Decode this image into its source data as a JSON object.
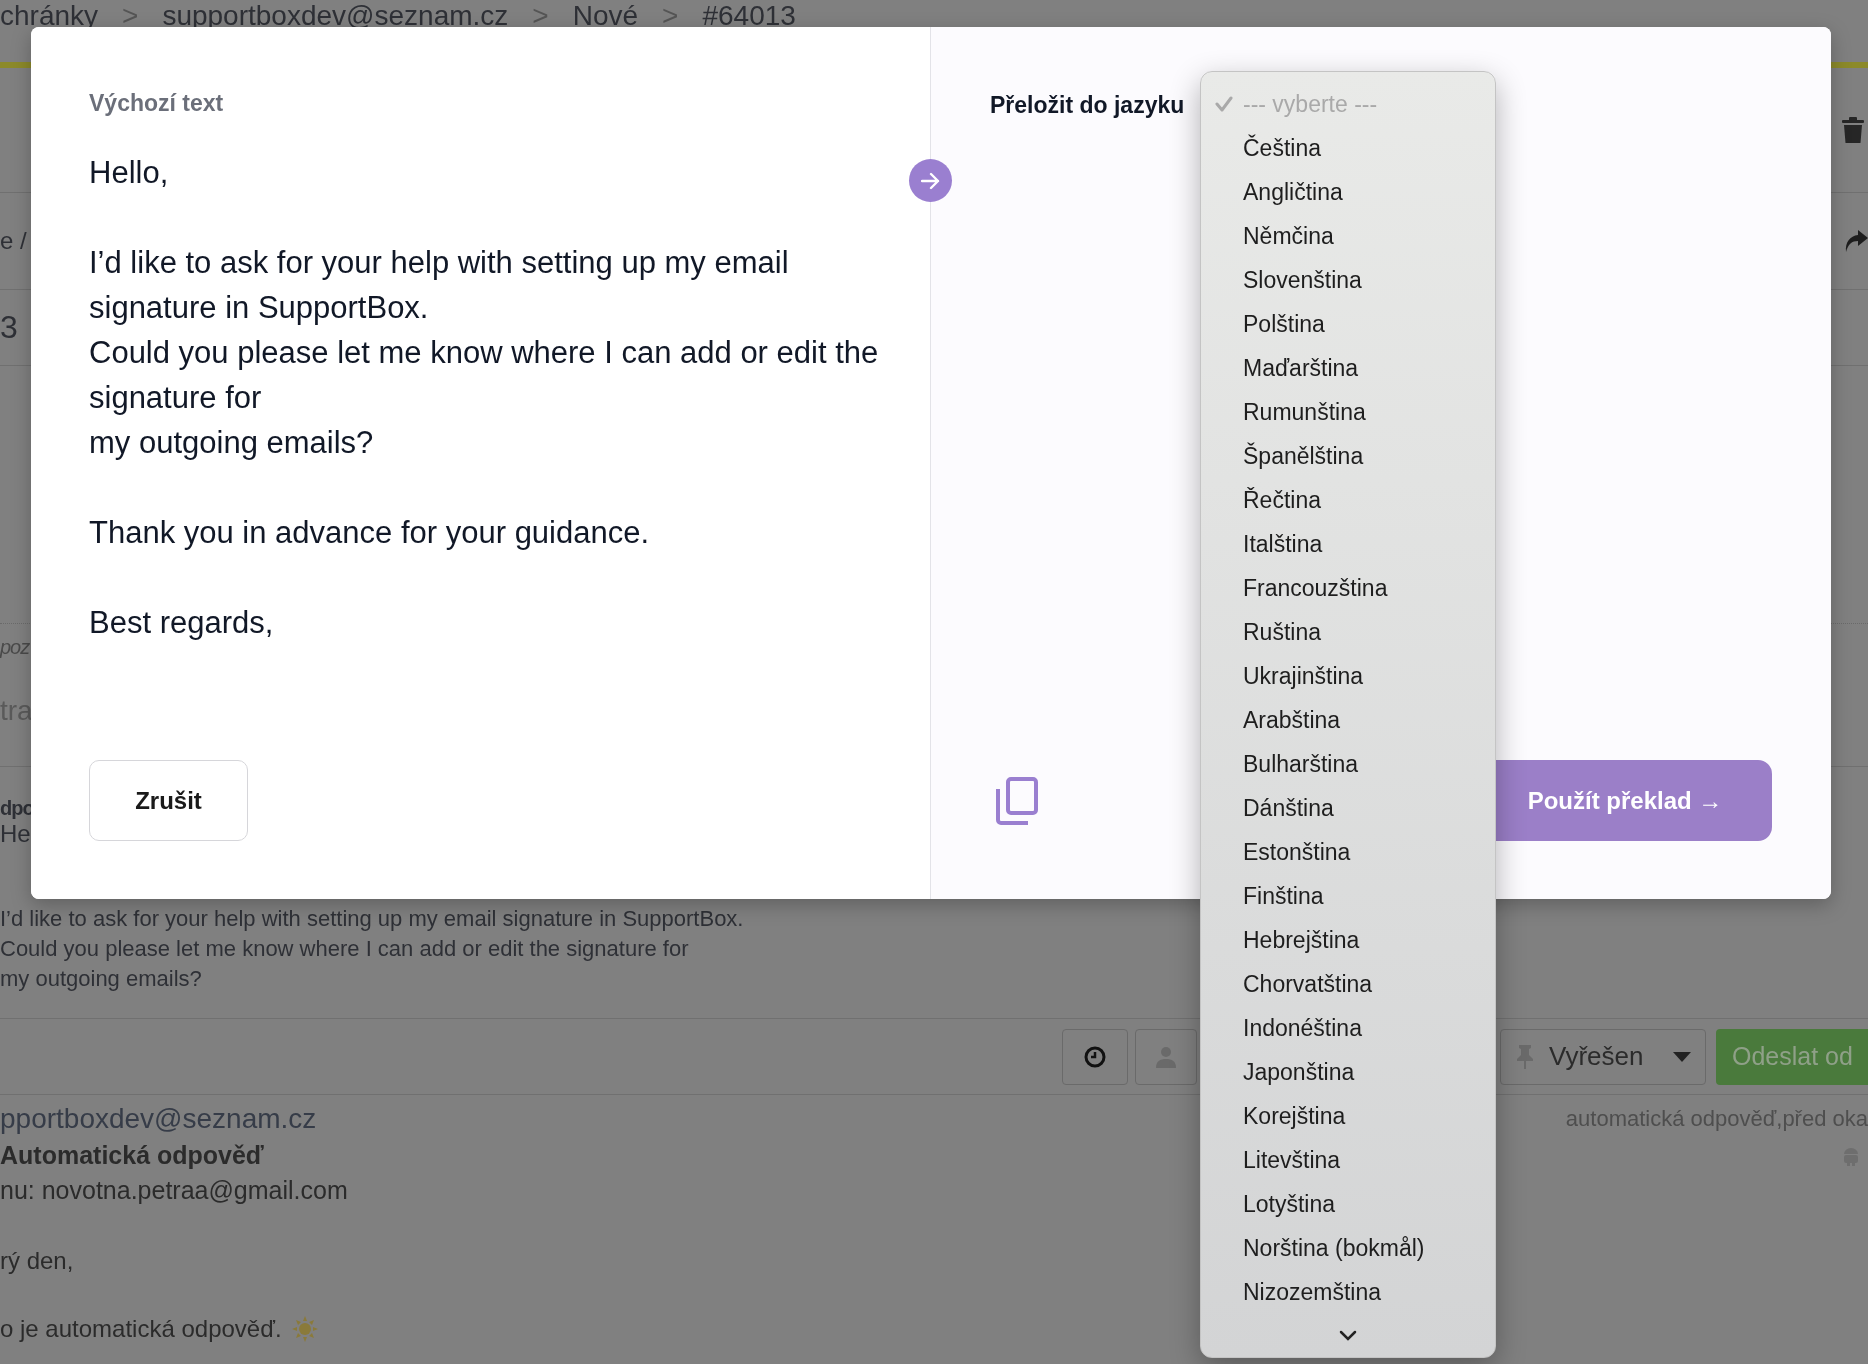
{
  "background": {
    "breadcrumb": [
      "chránky",
      "supportboxdev@seznam.cz",
      "Nové",
      "#64013"
    ],
    "breadcrumb_separator": ">",
    "side_fragments": [
      {
        "text": "e /",
        "kind": "plain"
      },
      {
        "text": "3",
        "kind": "large"
      },
      {
        "text": "poz",
        "kind": "italic"
      },
      {
        "text": "tra",
        "kind": "faded"
      },
      {
        "text": "dpo",
        "kind": "bold"
      },
      {
        "text": "He",
        "kind": "plain"
      }
    ],
    "message_preview": [
      "I’d like to ask for your help with setting up my email signature in SupportBox.",
      "Could you please let me know where I can add or edit the signature for",
      "my outgoing emails?"
    ],
    "toolbar": {
      "status": "Vyřešen",
      "send_button": "Odeslat od"
    },
    "reply": {
      "from": "pportboxdev@seznam.cz",
      "tags": "automatická odpověď,před oka",
      "subject": "Automatická odpověď",
      "to": "nu: novotna.petraa@gmail.com",
      "body": [
        "rý den,",
        "o je automatická odpověď."
      ]
    }
  },
  "dialog": {
    "source_label": "Výchozí text",
    "source_paragraphs": [
      [
        "Hello,"
      ],
      [
        "I’d like to ask for your help with setting up my email signature in SupportBox.",
        "Could you please let me know where I can add or edit the signature for",
        "my outgoing emails?"
      ],
      [
        "Thank you in advance for your guidance."
      ],
      [
        "Best regards,"
      ]
    ],
    "cancel_button": "Zrušit",
    "target_label": "Přeložit do jazyku",
    "apply_button": "Použít překlad →"
  },
  "language_menu": {
    "items": [
      {
        "label": "--- vyberte ---",
        "kind": "placeholder",
        "selected": true
      },
      {
        "label": "Čeština",
        "kind": "option",
        "selected": false
      },
      {
        "label": "Angličtina",
        "kind": "option",
        "selected": false
      },
      {
        "label": "Němčina",
        "kind": "option",
        "selected": false
      },
      {
        "label": "Slovenština",
        "kind": "option",
        "selected": false
      },
      {
        "label": "Polština",
        "kind": "option",
        "selected": false
      },
      {
        "label": "Maďarština",
        "kind": "option",
        "selected": false
      },
      {
        "label": "Rumunština",
        "kind": "option",
        "selected": false
      },
      {
        "label": "Španělština",
        "kind": "option",
        "selected": false
      },
      {
        "label": "Řečtina",
        "kind": "option",
        "selected": false
      },
      {
        "label": "Italština",
        "kind": "option",
        "selected": false
      },
      {
        "label": "Francouzština",
        "kind": "option",
        "selected": false
      },
      {
        "label": "Ruština",
        "kind": "option",
        "selected": false
      },
      {
        "label": "Ukrajinština",
        "kind": "option",
        "selected": false
      },
      {
        "label": "Arabština",
        "kind": "option",
        "selected": false
      },
      {
        "label": "Bulharština",
        "kind": "option",
        "selected": false
      },
      {
        "label": "Dánština",
        "kind": "option",
        "selected": false
      },
      {
        "label": "Estonština",
        "kind": "option",
        "selected": false
      },
      {
        "label": "Finština",
        "kind": "option",
        "selected": false
      },
      {
        "label": "Hebrejština",
        "kind": "option",
        "selected": false
      },
      {
        "label": "Chorvatština",
        "kind": "option",
        "selected": false
      },
      {
        "label": "Indonéština",
        "kind": "option",
        "selected": false
      },
      {
        "label": "Japonština",
        "kind": "option",
        "selected": false
      },
      {
        "label": "Korejština",
        "kind": "option",
        "selected": false
      },
      {
        "label": "Litevština",
        "kind": "option",
        "selected": false
      },
      {
        "label": "Lotyština",
        "kind": "option",
        "selected": false
      },
      {
        "label": "Norština (bokmål)",
        "kind": "option",
        "selected": false
      },
      {
        "label": "Nizozemština",
        "kind": "option",
        "selected": false
      }
    ]
  }
}
